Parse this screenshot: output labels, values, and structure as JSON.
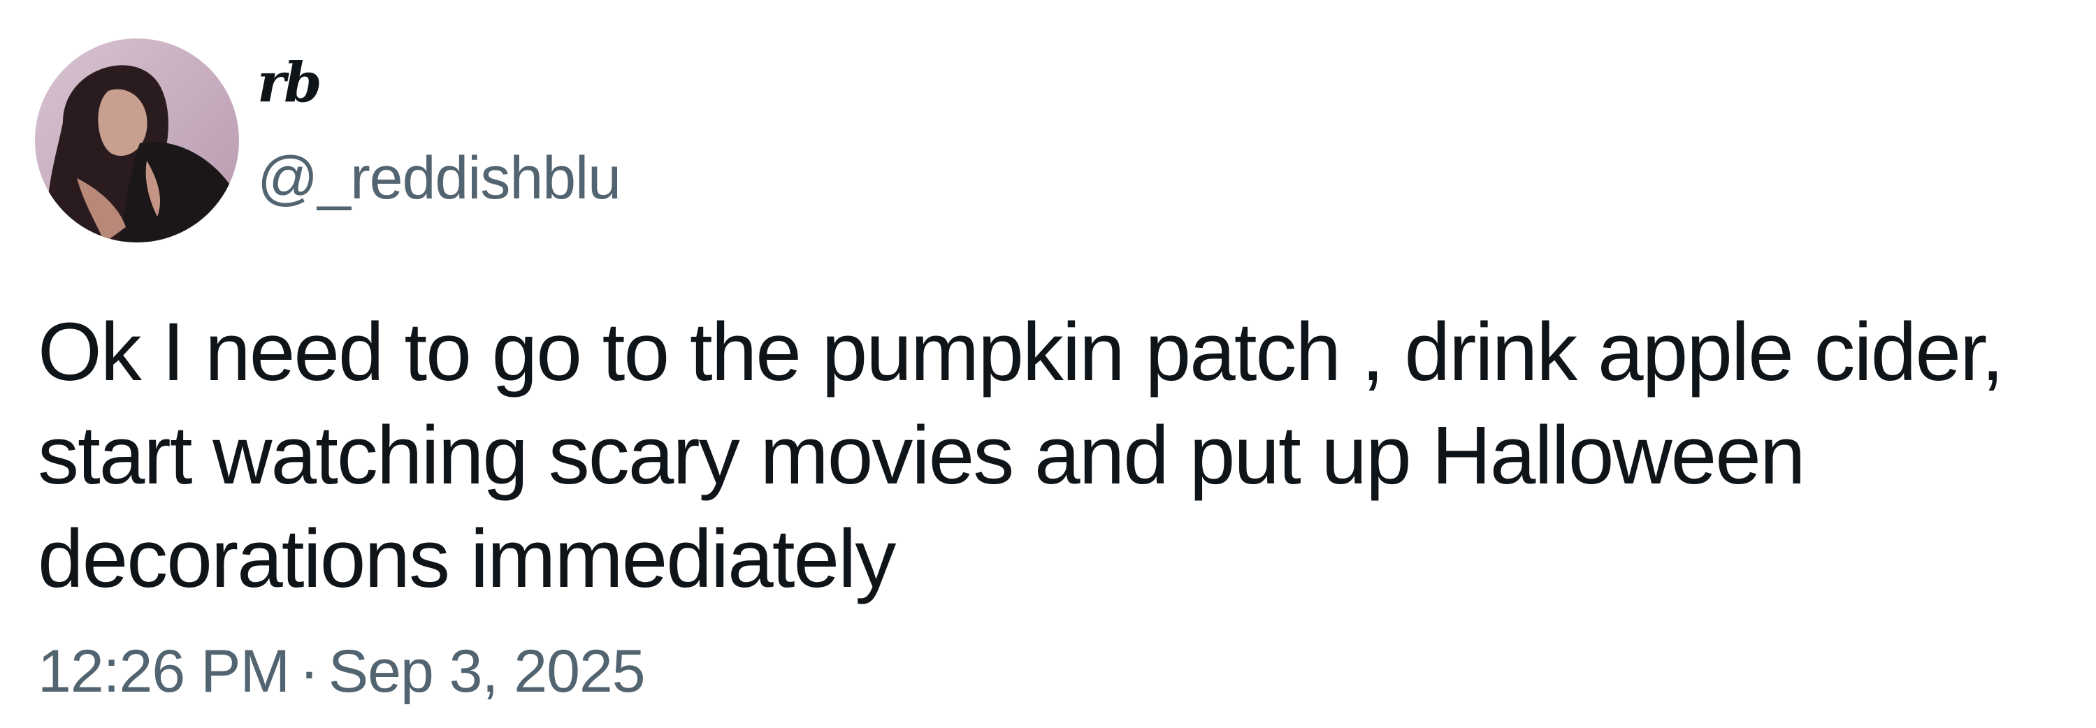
{
  "author": {
    "display_name": "rb",
    "handle": "@_reddishblu",
    "avatar_icon": "profile-photo"
  },
  "tweet": {
    "text_lines": [
      "Ok I need to go to the pumpkin patch , drink apple cider,",
      "start watching scary movies and put up Halloween",
      "decorations immediately"
    ],
    "time": "12:26 PM",
    "separator": "·",
    "date": "Sep 3, 2025"
  },
  "colors": {
    "text_primary": "#0f1419",
    "text_secondary": "#536471",
    "background": "#ffffff"
  }
}
